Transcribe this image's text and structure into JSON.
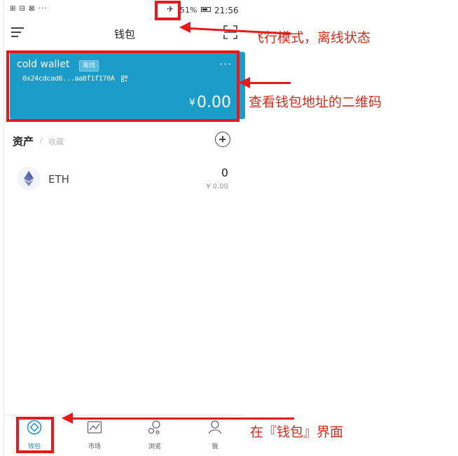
{
  "status_bar": {
    "left_icons": "⊞ ⊟ ⊠ ···",
    "battery": "51%",
    "time": "21:56"
  },
  "header": {
    "title": "钱包"
  },
  "wallet_card": {
    "name": "cold wallet",
    "badge": "离线",
    "address": "0x24cdcad6...aa8f1f170A",
    "currency_symbol": "¥",
    "balance": "0.00",
    "more": "···",
    "color": "#1b9cc9"
  },
  "assets": {
    "title": "资产",
    "separator": "/",
    "favorites": "收藏",
    "items": [
      {
        "symbol": "ETH",
        "amount": "0",
        "value": "¥ 0.00",
        "icon": "ethereum-icon"
      }
    ]
  },
  "bottom_nav": {
    "items": [
      {
        "label": "钱包",
        "icon": "wallet-icon",
        "active": true
      },
      {
        "label": "市场",
        "icon": "market-chart-icon",
        "active": false
      },
      {
        "label": "浏览",
        "icon": "browse-icon",
        "active": false
      },
      {
        "label": "我",
        "icon": "profile-icon",
        "active": false
      }
    ],
    "active_color": "#1a8fd0"
  },
  "annotations": {
    "airplane_mode": "飞行模式，离线状态",
    "qr_code": "查看钱包地址的二维码",
    "wallet_page": "在『钱包』界面",
    "color": "#e8191b"
  }
}
